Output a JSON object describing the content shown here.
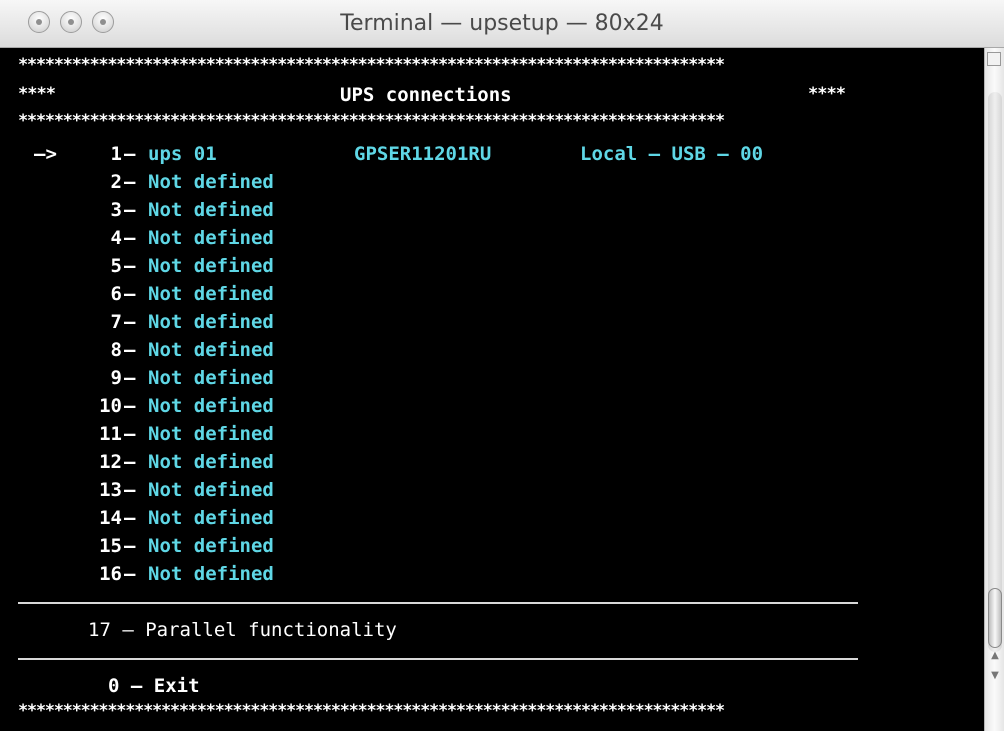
{
  "window": {
    "title": "Terminal — upsetup — 80x24"
  },
  "screen": {
    "stars_line": "*******************************************************************************",
    "header_left": "****",
    "header_title": "UPS connections",
    "header_right": "****",
    "arrow": "—>",
    "dash": "–",
    "connections": [
      {
        "num": "1",
        "name": "ups 01",
        "serial": "GPSER11201RU",
        "connection": "Local – USB – 00"
      },
      {
        "num": "2",
        "name": "Not defined"
      },
      {
        "num": "3",
        "name": "Not defined"
      },
      {
        "num": "4",
        "name": "Not defined"
      },
      {
        "num": "5",
        "name": "Not defined"
      },
      {
        "num": "6",
        "name": "Not defined"
      },
      {
        "num": "7",
        "name": "Not defined"
      },
      {
        "num": "8",
        "name": "Not defined"
      },
      {
        "num": "9",
        "name": "Not defined"
      },
      {
        "num": "10",
        "name": "Not defined"
      },
      {
        "num": "11",
        "name": "Not defined"
      },
      {
        "num": "12",
        "name": "Not defined"
      },
      {
        "num": "13",
        "name": "Not defined"
      },
      {
        "num": "14",
        "name": "Not defined"
      },
      {
        "num": "15",
        "name": "Not defined"
      },
      {
        "num": "16",
        "name": "Not defined"
      }
    ],
    "parallel_option": "17 – Parallel functionality",
    "exit_option": "0 – Exit"
  },
  "colors": {
    "terminal_bg": "#000000",
    "text": "#ffffff",
    "accent": "#5fd7e6"
  }
}
